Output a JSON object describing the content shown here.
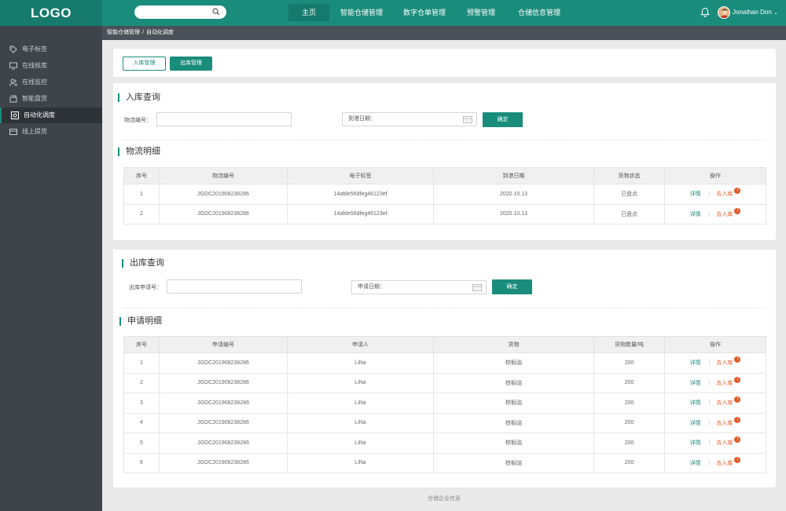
{
  "header": {
    "logo": "LOGO",
    "nav": [
      "主页",
      "智能仓储管理",
      "数字仓单管理",
      "预警管理",
      "仓储信息管理"
    ],
    "user_name": "Jonathan Don"
  },
  "sidebar": {
    "items": [
      {
        "label": "电子标签",
        "icon": "tag-icon"
      },
      {
        "label": "在线核库",
        "icon": "monitor-icon"
      },
      {
        "label": "在线监控",
        "icon": "users-icon"
      },
      {
        "label": "智能盘货",
        "icon": "layers-icon"
      },
      {
        "label": "自动化调度",
        "icon": "schedule-icon"
      },
      {
        "label": "线上提货",
        "icon": "box-icon"
      }
    ],
    "active_index": 4
  },
  "breadcrumb": {
    "parent": "智能仓储管理",
    "current": "自动化调度"
  },
  "tabs": {
    "inbound": "入库管理",
    "outbound": "出库管理"
  },
  "inbound_query": {
    "title": "入库查询",
    "tracking_label": "物流编号：",
    "date_label": "到港日期：",
    "confirm": "确定"
  },
  "logistics": {
    "title": "物流明细",
    "headers": [
      "序号",
      "物流编号",
      "电子标签",
      "到港日期",
      "货物状态",
      "操作"
    ],
    "rows": [
      {
        "no": "1",
        "code": "JGDC201908238286",
        "tag": "14afde56dfeg46123ef",
        "date": "2020.10.13",
        "status": "已盘点"
      },
      {
        "no": "2",
        "code": "JGDC201908238286",
        "tag": "14afde56dfeg46123ef",
        "date": "2020.10.13",
        "status": "已盘点"
      }
    ]
  },
  "outbound_query": {
    "title": "出库查询",
    "apply_label": "出库申请号：",
    "date_label": "申请日期：",
    "confirm": "确定"
  },
  "apply": {
    "title": "申请明细",
    "headers": [
      "序号",
      "申请编号",
      "申请人",
      "货物",
      "货物数量/吨",
      "操作"
    ],
    "rows": [
      {
        "no": "1",
        "code": "JGDC201908238286",
        "person": "LiNa",
        "goods": "棕榈油",
        "qty": "200"
      },
      {
        "no": "2",
        "code": "JGDC201908238286",
        "person": "LiNa",
        "goods": "棕榈油",
        "qty": "200"
      },
      {
        "no": "3",
        "code": "JGDC201908238286",
        "person": "LiNa",
        "goods": "棕榈油",
        "qty": "200"
      },
      {
        "no": "4",
        "code": "JGDC201908238286",
        "person": "LiNa",
        "goods": "棕榈油",
        "qty": "200"
      },
      {
        "no": "5",
        "code": "JGDC201908238286",
        "person": "LiNa",
        "goods": "棕榈油",
        "qty": "200"
      },
      {
        "no": "6",
        "code": "JGDC201908238286",
        "person": "LiNa",
        "goods": "棕榈油",
        "qty": "200"
      }
    ]
  },
  "ops": {
    "detail": "详情",
    "sep": "|",
    "cta": "去入库",
    "badge": "!"
  },
  "footer": "仓储企业信息",
  "colors": {
    "primary": "#1a8c7c",
    "sidebar": "#3e444a",
    "warn": "#e05a2b"
  }
}
